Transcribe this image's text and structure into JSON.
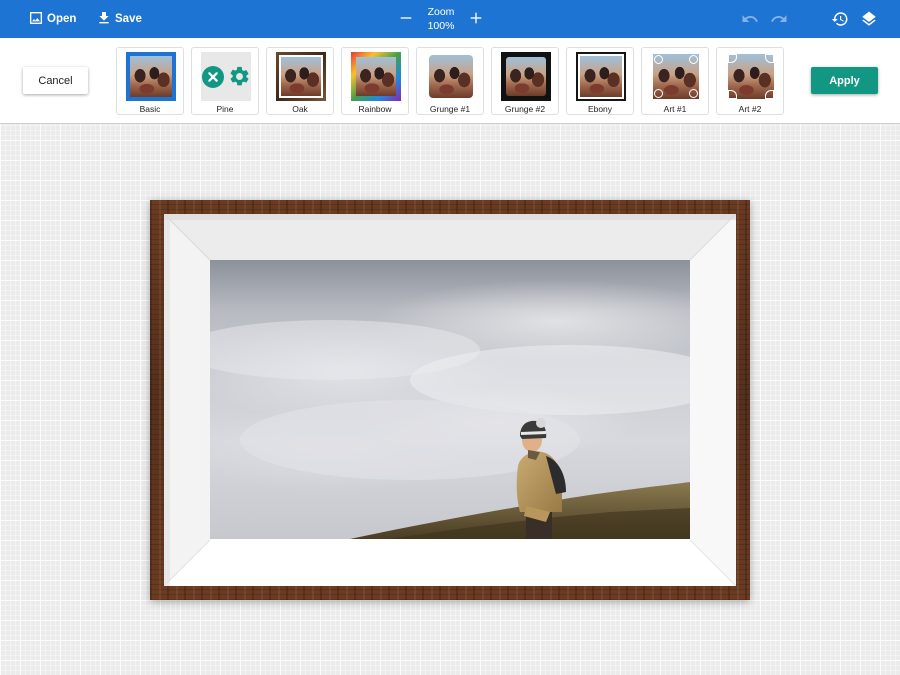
{
  "toolbar": {
    "open_label": "Open",
    "save_label": "Save",
    "zoom_label": "Zoom",
    "zoom_value": "100%",
    "icons": {
      "open": "image-icon",
      "save": "download-icon",
      "zoom_out": "minus-icon",
      "zoom_in": "plus-icon",
      "undo": "undo-icon",
      "redo": "redo-icon",
      "history": "history-icon",
      "layers": "layers-icon"
    },
    "undo_enabled": false,
    "redo_enabled": false
  },
  "frames_panel": {
    "cancel_label": "Cancel",
    "apply_label": "Apply",
    "frames": [
      {
        "label": "Basic",
        "style": "basic"
      },
      {
        "label": "Pine",
        "style": "pine",
        "selected": true
      },
      {
        "label": "Oak",
        "style": "oak"
      },
      {
        "label": "Rainbow",
        "style": "rainbow"
      },
      {
        "label": "Grunge #1",
        "style": "grunge1"
      },
      {
        "label": "Grunge #2",
        "style": "grunge2"
      },
      {
        "label": "Ebony",
        "style": "ebony"
      },
      {
        "label": "Art #1",
        "style": "art1"
      },
      {
        "label": "Art #2",
        "style": "art2"
      }
    ]
  },
  "colors": {
    "topbar": "#1e74d2",
    "accent": "#129882",
    "frame_wood": "#5b321e"
  }
}
